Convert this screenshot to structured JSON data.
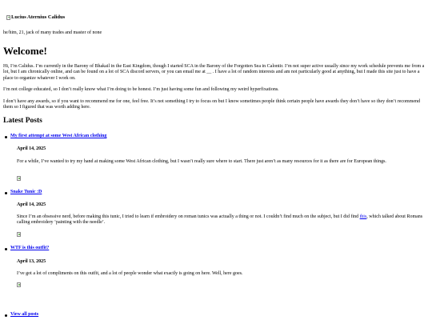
{
  "site": {
    "logo_alt": "Lucius Aternius Calidus",
    "tagline": "he/him, 21, jack of many trades and master of none"
  },
  "welcome": {
    "heading": "Welcome!",
    "paragraph1_a": "Hi, I’m Calidus. I’m currently in the Barony of Bhakail in the East Kingdom, though I started SCA in the Barony of the Forgotten Sea in Calontir. I’m not super active usually since my work schedule prevents me from a lot, but I am chronically online, and can be found on a lot of SCA discord servers, or you can email me at ",
    "paragraph1_email": "__",
    "paragraph1_b": " . I have a lot of random interests and am not particularly good at anything, but I made this site just to have a place to organize whatever I work on.",
    "paragraph2": "I’m not college educated, so I don’t really know what I’m doing to be honest. I’m just having some fun and following my weird hyperfixations.",
    "paragraph3": "I don’t have any awards, so if you want to recommend me for one, feel free. It’s not something I try to focus on but I know sometimes people think certain people have awards they don’t have so they don’t recommend them so I figured that was worth adding here."
  },
  "latest_posts": {
    "heading": "Latest Posts",
    "posts": [
      {
        "title": "My first attempt at some West African clothing",
        "date": "April 14, 2025",
        "excerpt": "For a while, I’ve wanted to try my hand at making some West African clothing, but I wasn’t really sure where to start. There just aren’t as many resources for it as there are for European things."
      },
      {
        "title": "Snake Tunic :D",
        "date": "April 14, 2025",
        "excerpt_a": "Since I’m an obsessive nerd, before making this tunic, I tried to learn if embroidery on roman tunics was actually a thing or not. I couldn’t find much on the subject, but I did find ",
        "excerpt_link": "this",
        "excerpt_b": ", which talked about Romans calling embroidery ‘painting with the needle’."
      },
      {
        "title": "WTF is this outfit?",
        "date": "April 13, 2025",
        "excerpt": "I’ve got a lot of compliments on this outfit, and a lot of people wonder what exactly is going on here. Well, here goes."
      }
    ],
    "view_all": "View all posts"
  },
  "icons": {
    "broken_image": "broken-image-icon",
    "bullet": "bullet-icon"
  },
  "colors": {
    "link": "#0000ee",
    "text": "#000000",
    "background": "#ffffff"
  }
}
